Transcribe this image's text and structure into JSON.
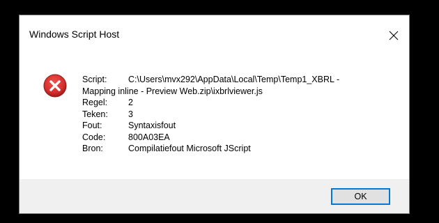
{
  "dialog": {
    "title": "Windows Script Host",
    "close_icon": "close-icon",
    "icon": "error-icon",
    "icon_color": "#d32f2f"
  },
  "message": {
    "script_label": "Script:",
    "script_value_line1": "C:\\Users\\mvx292\\AppData\\Local\\Temp\\Temp1_XBRL -",
    "script_value_line2": "Mapping inline - Preview Web.zip\\ixbrlviewer.js",
    "rows": [
      {
        "label": "Regel:",
        "value": "2"
      },
      {
        "label": "Teken:",
        "value": "3"
      },
      {
        "label": "Fout:",
        "value": "Syntaxisfout"
      },
      {
        "label": "Code:",
        "value": "800A03EA"
      },
      {
        "label": "Bron:",
        "value": "Compilatiefout Microsoft JScript"
      }
    ]
  },
  "footer": {
    "ok_label": "OK",
    "accent": "#0078d7"
  }
}
